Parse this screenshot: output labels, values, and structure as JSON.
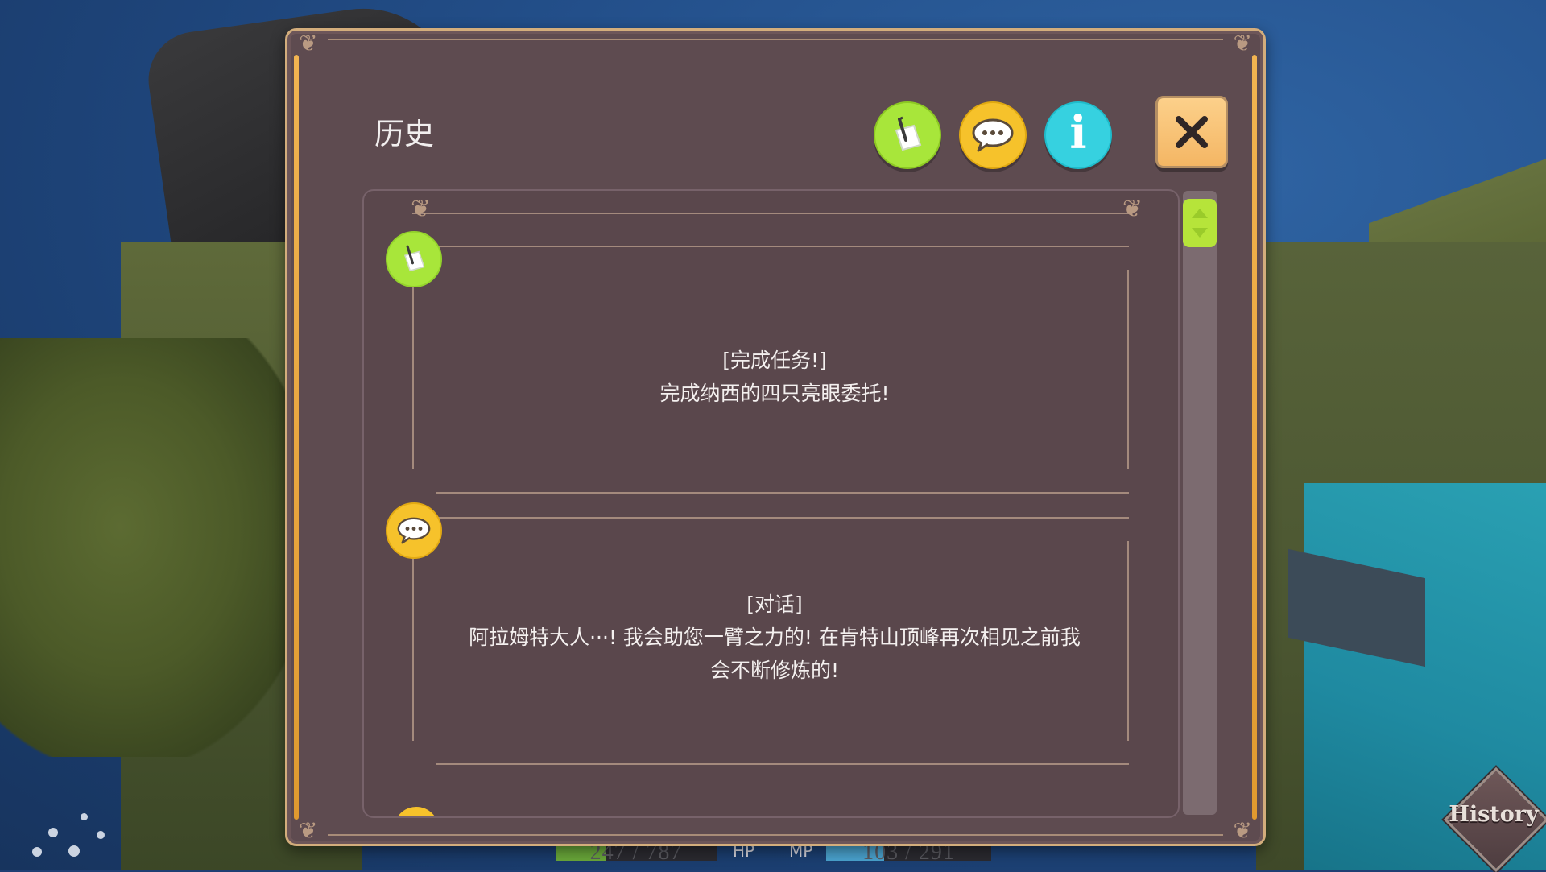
{
  "panel": {
    "title": "历史"
  },
  "entries": [
    {
      "type": "quest",
      "icon": "quest-scroll-icon",
      "heading": "[完成任务!]",
      "text": "完成纳西的四只亮眼委托!"
    },
    {
      "type": "dialog",
      "icon": "speech-bubble-icon",
      "heading": "[对话]",
      "text_line1": "阿拉姆特大人···! 我会助您一臂之力的! 在肯特山顶峰再次相见之前我",
      "text_line2": "会不断修炼的!"
    }
  ],
  "status": {
    "hp_value": "247 / 787",
    "hp_label": "HP",
    "hp_fraction": 0.31,
    "mp_label": "MP",
    "mp_value": "103 / 291",
    "mp_fraction": 0.35
  },
  "badge": {
    "label": "History"
  },
  "colors": {
    "panel_bg": "#5e4b50",
    "border_gold": "#d3ad7c",
    "quest_green": "#a8e63a",
    "dialog_yellow": "#f6c22b",
    "info_cyan": "#36d1e0",
    "close_orange": "#f4b664"
  }
}
